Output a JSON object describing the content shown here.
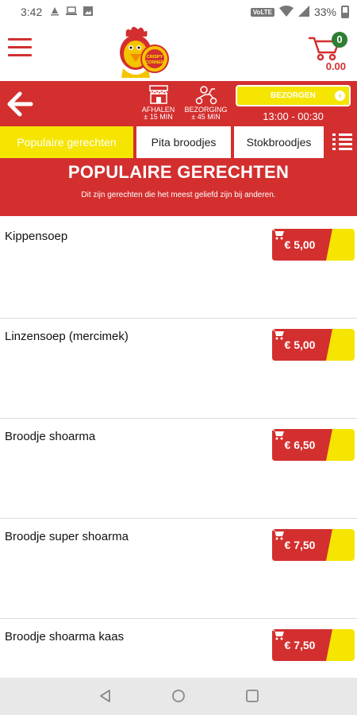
{
  "status_bar": {
    "time": "3:42",
    "network": "VoLTE",
    "battery": "33%",
    "icons": [
      "notification-icon",
      "laptop-icon",
      "image-icon",
      "wifi-icon",
      "signal-icon",
      "battery-icon"
    ]
  },
  "header": {
    "cart_count": "0",
    "cart_total": "0.00",
    "logo_text": "CRISPY CORNER"
  },
  "info_bar": {
    "pickup_label": "AFHALEN",
    "pickup_time": "± 15 MIN",
    "delivery_label": "BEZORGING",
    "delivery_time": "± 45 MIN",
    "mode_button": "BEZORGEN",
    "hours": "13:00 - 00:30"
  },
  "tabs": [
    {
      "label": "Populaire gerechten",
      "active": true
    },
    {
      "label": "Pita broodjes",
      "active": false
    },
    {
      "label": "Stokbroodjes",
      "active": false
    }
  ],
  "section": {
    "title": "POPULAIRE GERECHTEN",
    "subtitle": "Dit zijn gerechten die het meest geliefd zijn bij anderen."
  },
  "products": [
    {
      "name": "Kippensoep",
      "price": "€ 5,00"
    },
    {
      "name": "Linzensoep (mercimek)",
      "price": "€ 5,00"
    },
    {
      "name": "Broodje shoarma",
      "price": "€ 6,50"
    },
    {
      "name": "Broodje super shoarma",
      "price": "€ 7,50"
    },
    {
      "name": "Broodje shoarma kaas",
      "price": "€ 7,50"
    }
  ],
  "colors": {
    "primary_red": "#d32f2f",
    "accent_yellow": "#f5e500",
    "badge_green": "#2e7d32"
  }
}
